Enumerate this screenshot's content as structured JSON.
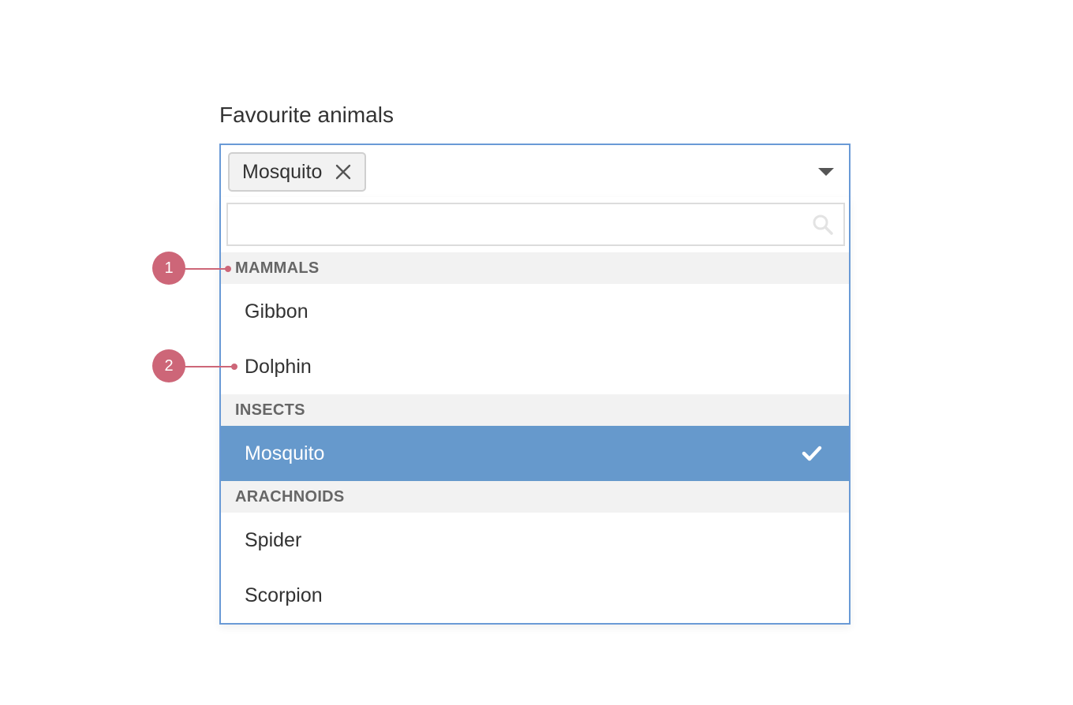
{
  "field": {
    "label": "Favourite animals"
  },
  "select": {
    "chips": [
      {
        "label": "Mosquito"
      }
    ],
    "search_placeholder": ""
  },
  "groups": [
    {
      "header": "MAMMALS",
      "options": [
        {
          "label": "Gibbon",
          "selected": false
        },
        {
          "label": "Dolphin",
          "selected": false
        }
      ]
    },
    {
      "header": "INSECTS",
      "options": [
        {
          "label": "Mosquito",
          "selected": true
        }
      ]
    },
    {
      "header": "ARACHNOIDS",
      "options": [
        {
          "label": "Spider",
          "selected": false
        },
        {
          "label": "Scorpion",
          "selected": false
        }
      ]
    }
  ],
  "annotations": [
    {
      "number": "1"
    },
    {
      "number": "2"
    }
  ],
  "colors": {
    "accent_border": "#6a9ad6",
    "selected_background": "#6699cc",
    "group_header_background": "#f2f2f2",
    "annotation": "#cd6678"
  },
  "icons": {
    "chip_remove": "close-icon",
    "toggle": "caret-down-icon",
    "search": "search-icon",
    "selected": "check-icon"
  }
}
